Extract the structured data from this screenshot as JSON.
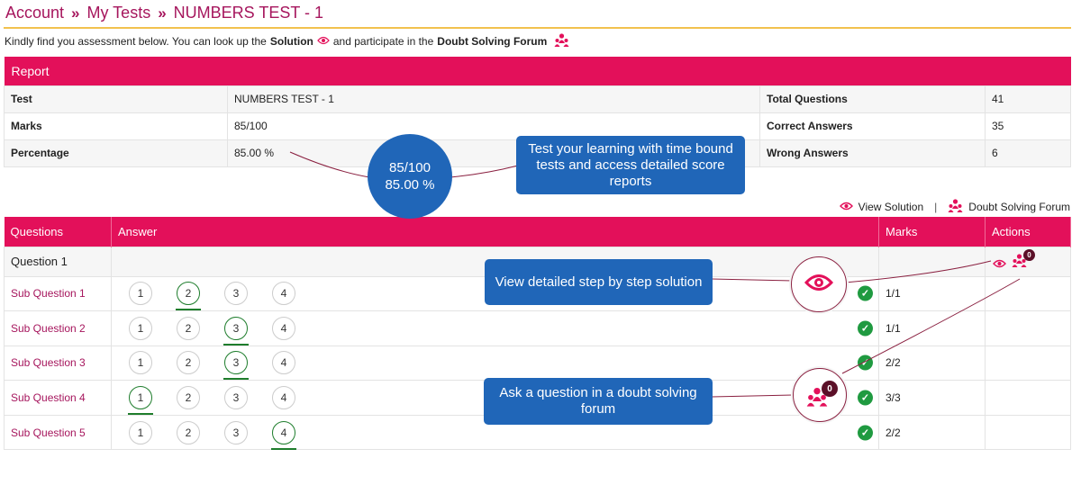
{
  "breadcrumb": {
    "account": "Account",
    "my_tests": "My Tests",
    "current": "NUMBERS TEST - 1",
    "separator": "»"
  },
  "intro": {
    "text1": "Kindly find you assessment below. You can look up the",
    "solution": "Solution",
    "text2": "and participate in the",
    "forum": "Doubt Solving Forum"
  },
  "report": {
    "heading": "Report",
    "rows": [
      {
        "l1": "Test",
        "v1": "NUMBERS TEST - 1",
        "l2": "Total Questions",
        "v2": "41"
      },
      {
        "l1": "Marks",
        "v1": "85/100",
        "l2": "Correct Answers",
        "v2": "35"
      },
      {
        "l1": "Percentage",
        "v1": "85.00 %",
        "l2": "Wrong Answers",
        "v2": "6"
      }
    ]
  },
  "links": {
    "view_solution": "View Solution",
    "separator": "|",
    "doubt_forum": "Doubt Solving Forum"
  },
  "questions_table": {
    "headers": {
      "questions": "Questions",
      "answer": "Answer",
      "marks": "Marks",
      "actions": "Actions"
    },
    "group_label": "Question 1",
    "forum_count": "0",
    "subs": [
      {
        "name": "Sub Question 1",
        "options": [
          "1",
          "2",
          "3",
          "4"
        ],
        "correct": 1,
        "marks": "1/1"
      },
      {
        "name": "Sub Question 2",
        "options": [
          "1",
          "2",
          "3",
          "4"
        ],
        "correct": 2,
        "marks": "1/1"
      },
      {
        "name": "Sub Question 3",
        "options": [
          "1",
          "2",
          "3",
          "4"
        ],
        "correct": 2,
        "marks": "2/2"
      },
      {
        "name": "Sub Question 4",
        "options": [
          "1",
          "2",
          "3",
          "4"
        ],
        "correct": 0,
        "marks": "3/3"
      },
      {
        "name": "Sub Question 5",
        "options": [
          "1",
          "2",
          "3",
          "4"
        ],
        "correct": 3,
        "marks": "2/2"
      }
    ]
  },
  "callouts": {
    "score_marks": "85/100",
    "score_percent": "85.00 %",
    "learning": "Test your learning with time bound tests and access detailed score reports",
    "solution": "View detailed step by step solution",
    "forum": "Ask a question in a doubt solving forum",
    "forum_count": "0"
  },
  "colors": {
    "brand": "#e3105a",
    "link": "#a6165d",
    "callout": "#2066b8",
    "correct": "#1e7d2c",
    "accent_rule": "#f2c14e"
  },
  "icons": {
    "eye": "eye-icon",
    "forum": "group-users-icon",
    "check": "check-circle-icon"
  }
}
